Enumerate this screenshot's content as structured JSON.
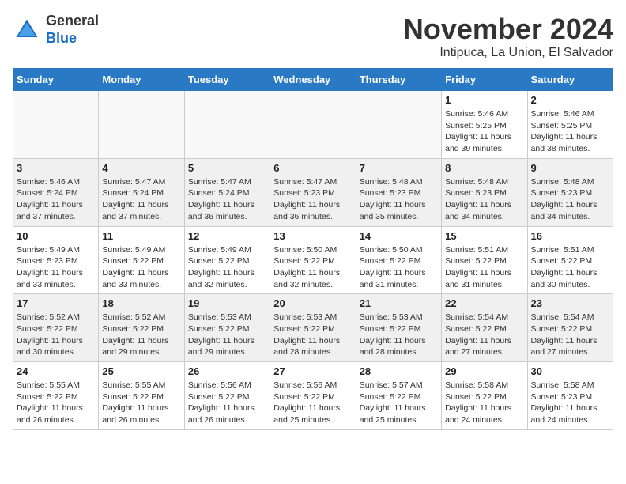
{
  "logo": {
    "general": "General",
    "blue": "Blue"
  },
  "title": {
    "month": "November 2024",
    "location": "Intipuca, La Union, El Salvador"
  },
  "weekdays": [
    "Sunday",
    "Monday",
    "Tuesday",
    "Wednesday",
    "Thursday",
    "Friday",
    "Saturday"
  ],
  "weeks": [
    [
      {
        "day": "",
        "info": ""
      },
      {
        "day": "",
        "info": ""
      },
      {
        "day": "",
        "info": ""
      },
      {
        "day": "",
        "info": ""
      },
      {
        "day": "",
        "info": ""
      },
      {
        "day": "1",
        "info": "Sunrise: 5:46 AM\nSunset: 5:25 PM\nDaylight: 11 hours\nand 39 minutes."
      },
      {
        "day": "2",
        "info": "Sunrise: 5:46 AM\nSunset: 5:25 PM\nDaylight: 11 hours\nand 38 minutes."
      }
    ],
    [
      {
        "day": "3",
        "info": "Sunrise: 5:46 AM\nSunset: 5:24 PM\nDaylight: 11 hours\nand 37 minutes."
      },
      {
        "day": "4",
        "info": "Sunrise: 5:47 AM\nSunset: 5:24 PM\nDaylight: 11 hours\nand 37 minutes."
      },
      {
        "day": "5",
        "info": "Sunrise: 5:47 AM\nSunset: 5:24 PM\nDaylight: 11 hours\nand 36 minutes."
      },
      {
        "day": "6",
        "info": "Sunrise: 5:47 AM\nSunset: 5:23 PM\nDaylight: 11 hours\nand 36 minutes."
      },
      {
        "day": "7",
        "info": "Sunrise: 5:48 AM\nSunset: 5:23 PM\nDaylight: 11 hours\nand 35 minutes."
      },
      {
        "day": "8",
        "info": "Sunrise: 5:48 AM\nSunset: 5:23 PM\nDaylight: 11 hours\nand 34 minutes."
      },
      {
        "day": "9",
        "info": "Sunrise: 5:48 AM\nSunset: 5:23 PM\nDaylight: 11 hours\nand 34 minutes."
      }
    ],
    [
      {
        "day": "10",
        "info": "Sunrise: 5:49 AM\nSunset: 5:23 PM\nDaylight: 11 hours\nand 33 minutes."
      },
      {
        "day": "11",
        "info": "Sunrise: 5:49 AM\nSunset: 5:22 PM\nDaylight: 11 hours\nand 33 minutes."
      },
      {
        "day": "12",
        "info": "Sunrise: 5:49 AM\nSunset: 5:22 PM\nDaylight: 11 hours\nand 32 minutes."
      },
      {
        "day": "13",
        "info": "Sunrise: 5:50 AM\nSunset: 5:22 PM\nDaylight: 11 hours\nand 32 minutes."
      },
      {
        "day": "14",
        "info": "Sunrise: 5:50 AM\nSunset: 5:22 PM\nDaylight: 11 hours\nand 31 minutes."
      },
      {
        "day": "15",
        "info": "Sunrise: 5:51 AM\nSunset: 5:22 PM\nDaylight: 11 hours\nand 31 minutes."
      },
      {
        "day": "16",
        "info": "Sunrise: 5:51 AM\nSunset: 5:22 PM\nDaylight: 11 hours\nand 30 minutes."
      }
    ],
    [
      {
        "day": "17",
        "info": "Sunrise: 5:52 AM\nSunset: 5:22 PM\nDaylight: 11 hours\nand 30 minutes."
      },
      {
        "day": "18",
        "info": "Sunrise: 5:52 AM\nSunset: 5:22 PM\nDaylight: 11 hours\nand 29 minutes."
      },
      {
        "day": "19",
        "info": "Sunrise: 5:53 AM\nSunset: 5:22 PM\nDaylight: 11 hours\nand 29 minutes."
      },
      {
        "day": "20",
        "info": "Sunrise: 5:53 AM\nSunset: 5:22 PM\nDaylight: 11 hours\nand 28 minutes."
      },
      {
        "day": "21",
        "info": "Sunrise: 5:53 AM\nSunset: 5:22 PM\nDaylight: 11 hours\nand 28 minutes."
      },
      {
        "day": "22",
        "info": "Sunrise: 5:54 AM\nSunset: 5:22 PM\nDaylight: 11 hours\nand 27 minutes."
      },
      {
        "day": "23",
        "info": "Sunrise: 5:54 AM\nSunset: 5:22 PM\nDaylight: 11 hours\nand 27 minutes."
      }
    ],
    [
      {
        "day": "24",
        "info": "Sunrise: 5:55 AM\nSunset: 5:22 PM\nDaylight: 11 hours\nand 26 minutes."
      },
      {
        "day": "25",
        "info": "Sunrise: 5:55 AM\nSunset: 5:22 PM\nDaylight: 11 hours\nand 26 minutes."
      },
      {
        "day": "26",
        "info": "Sunrise: 5:56 AM\nSunset: 5:22 PM\nDaylight: 11 hours\nand 26 minutes."
      },
      {
        "day": "27",
        "info": "Sunrise: 5:56 AM\nSunset: 5:22 PM\nDaylight: 11 hours\nand 25 minutes."
      },
      {
        "day": "28",
        "info": "Sunrise: 5:57 AM\nSunset: 5:22 PM\nDaylight: 11 hours\nand 25 minutes."
      },
      {
        "day": "29",
        "info": "Sunrise: 5:58 AM\nSunset: 5:22 PM\nDaylight: 11 hours\nand 24 minutes."
      },
      {
        "day": "30",
        "info": "Sunrise: 5:58 AM\nSunset: 5:23 PM\nDaylight: 11 hours\nand 24 minutes."
      }
    ]
  ]
}
